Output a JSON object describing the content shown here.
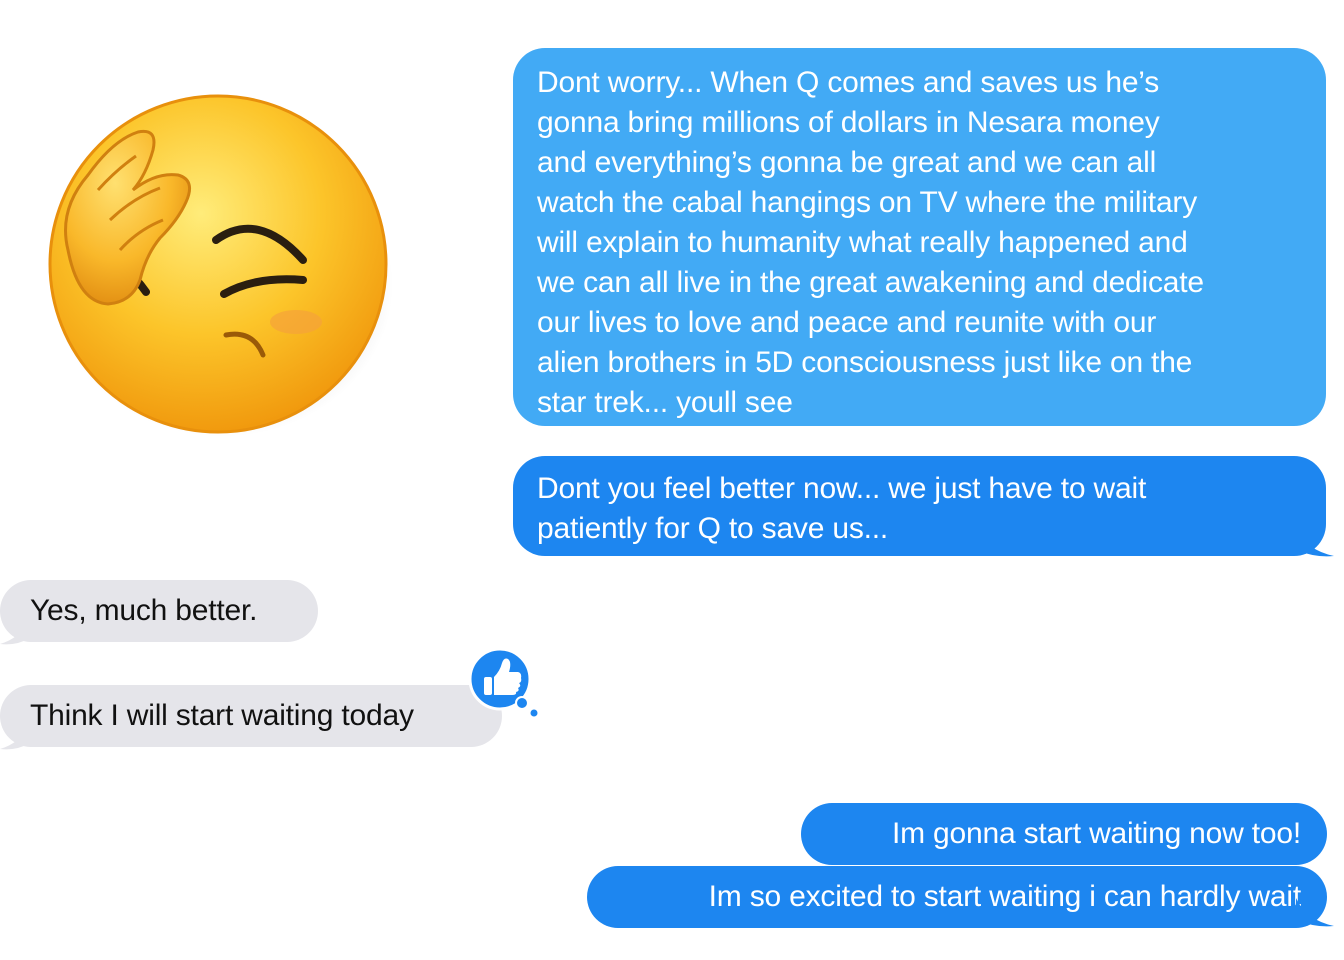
{
  "conversation": {
    "messages": [
      {
        "side": "sent",
        "text": "Dont worry... When Q comes and saves us he’s\ngonna bring millions of dollars in Nesara money\nand everything’s gonna be great and we can all\nwatch the cabal hangings on TV where the military\nwill explain to humanity what really happened and\nwe can all live in the great awakening and dedicate\nour lives to love and peace and reunite with our\nalien brothers in 5D consciousness just like on the\nstar trek...  youll see"
      },
      {
        "side": "sent",
        "text": "Dont you feel better now... we just have to wait\npatiently for Q to save us..."
      },
      {
        "side": "received",
        "text": "Yes, much better."
      },
      {
        "side": "received",
        "text": "Think I will start waiting today",
        "reaction": "thumbs-up-icon"
      },
      {
        "side": "sent",
        "text": "Im gonna start waiting now too!"
      },
      {
        "side": "sent",
        "text": "Im so excited to start waiting i can hardly wait"
      }
    ]
  },
  "decorations": {
    "emoji": "facepalm-emoji-icon"
  },
  "colors": {
    "sent_highlight": "#42aaf5",
    "sent": "#1d86f0",
    "received": "#e5e5ea",
    "received_text": "#111111",
    "emoji_yellow": "#fbbe1e",
    "emoji_dark": "#2a1e10"
  }
}
